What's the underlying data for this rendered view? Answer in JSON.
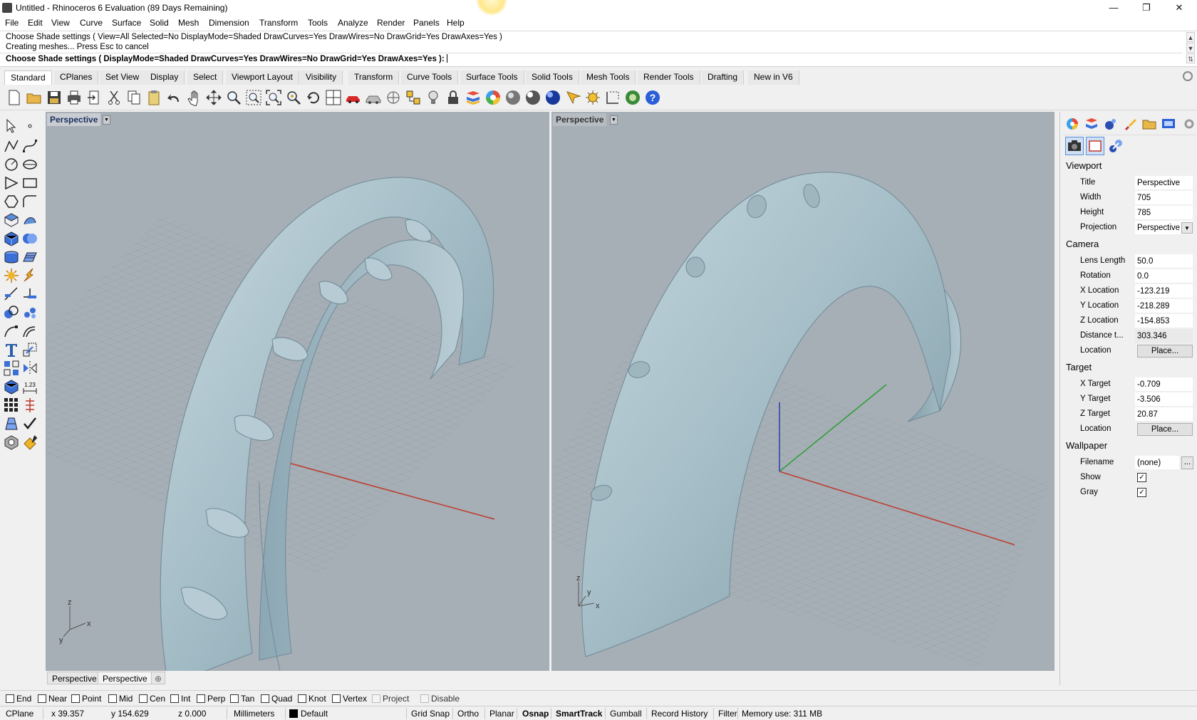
{
  "window": {
    "title": "Untitled - Rhinoceros 6 Evaluation (89 Days Remaining)"
  },
  "menu": [
    "File",
    "Edit",
    "View",
    "Curve",
    "Surface",
    "Solid",
    "Mesh",
    "Dimension",
    "Transform",
    "Tools",
    "Analyze",
    "Render",
    "Panels",
    "Help"
  ],
  "command": {
    "history1": "Choose Shade settings ( View=All  Selected=No  DisplayMode=Shaded  DrawCurves=Yes  DrawWires=No  DrawGrid=Yes  DrawAxes=Yes )",
    "history2": "Creating meshes... Press Esc to cancel",
    "prompt": "Choose Shade settings ( DisplayMode=Shaded  DrawCurves=Yes  DrawWires=No  DrawGrid=Yes  DrawAxes=Yes ):"
  },
  "tabs": [
    "Standard",
    "CPlanes",
    "Set View",
    "Display",
    "Select",
    "Viewport Layout",
    "Visibility",
    "Transform",
    "Curve Tools",
    "Surface Tools",
    "Solid Tools",
    "Mesh Tools",
    "Render Tools",
    "Drafting",
    "New in V6"
  ],
  "toolbar_icons": [
    "new-icon",
    "open-icon",
    "save-icon",
    "print-icon",
    "import-icon",
    "cut-icon",
    "copy-icon",
    "paste-icon",
    "undo-icon",
    "pan-icon",
    "rotate-view-icon",
    "zoom-icon",
    "zoom-window-icon",
    "zoom-extents-icon",
    "zoom-selected-icon",
    "rotate-icon",
    "viewport-layout-icon",
    "car-icon",
    "named-view-icon",
    "cplane-icon",
    "snap-icon",
    "light-icon",
    "lock-icon",
    "layer-icon",
    "color-wheel-icon",
    "shaded-sphere-icon",
    "rendered-sphere-icon",
    "ghost-sphere-icon",
    "help-sphere-icon",
    "light-bulb-icon",
    "gear-settings-icon",
    "dimension-icon",
    "render-icon",
    "help-icon"
  ],
  "viewports": {
    "left": {
      "title": "Perspective"
    },
    "right": {
      "title": "Perspective"
    },
    "axis_labels": {
      "x": "x",
      "y": "y",
      "z": "z"
    }
  },
  "viewport_tabs": [
    "Perspective",
    "Perspective"
  ],
  "properties": {
    "viewport_section": "Viewport",
    "title_label": "Title",
    "title_value": "Perspective",
    "width_label": "Width",
    "width_value": "705",
    "height_label": "Height",
    "height_value": "785",
    "projection_label": "Projection",
    "projection_value": "Perspective",
    "camera_section": "Camera",
    "lens_label": "Lens Length",
    "lens_value": "50.0",
    "rotation_label": "Rotation",
    "rotation_value": "0.0",
    "xloc_label": "X Location",
    "xloc_value": "-123.219",
    "yloc_label": "Y Location",
    "yloc_value": "-218.289",
    "zloc_label": "Z Location",
    "zloc_value": "-154.853",
    "dist_label": "Distance t...",
    "dist_value": "303.346",
    "loc_label": "Location",
    "place_button": "Place...",
    "target_section": "Target",
    "xtarget_label": "X Target",
    "xtarget_value": "-0.709",
    "ytarget_label": "Y Target",
    "ytarget_value": "-3.506",
    "ztarget_label": "Z Target",
    "ztarget_value": "20.87",
    "tloc_label": "Location",
    "tplace_button": "Place...",
    "wallpaper_section": "Wallpaper",
    "filename_label": "Filename",
    "filename_value": "(none)",
    "browse_button": "...",
    "show_label": "Show",
    "show_checked": true,
    "gray_label": "Gray",
    "gray_checked": true
  },
  "osnap": {
    "items": [
      "End",
      "Near",
      "Point",
      "Mid",
      "Cen",
      "Int",
      "Perp",
      "Tan",
      "Quad",
      "Knot",
      "Vertex"
    ],
    "project": "Project",
    "disable": "Disable"
  },
  "status": {
    "cplane": "CPlane",
    "x": "x 39.357",
    "y": "y 154.629",
    "z": "z 0.000",
    "units": "Millimeters",
    "layer": "Default",
    "grid_snap": "Grid Snap",
    "ortho": "Ortho",
    "planar": "Planar",
    "osnap": "Osnap",
    "smarttrack": "SmartTrack",
    "gumball": "Gumball",
    "record_history": "Record History",
    "filter": "Filter",
    "memory": "Memory use: 311 MB"
  },
  "colors": {
    "viewport_bg": "#a6aeb6",
    "model": "#a9c0c9",
    "x_axis": "#c0392b",
    "y_axis": "#2e9e3a",
    "z_axis": "#2b3fb0"
  }
}
